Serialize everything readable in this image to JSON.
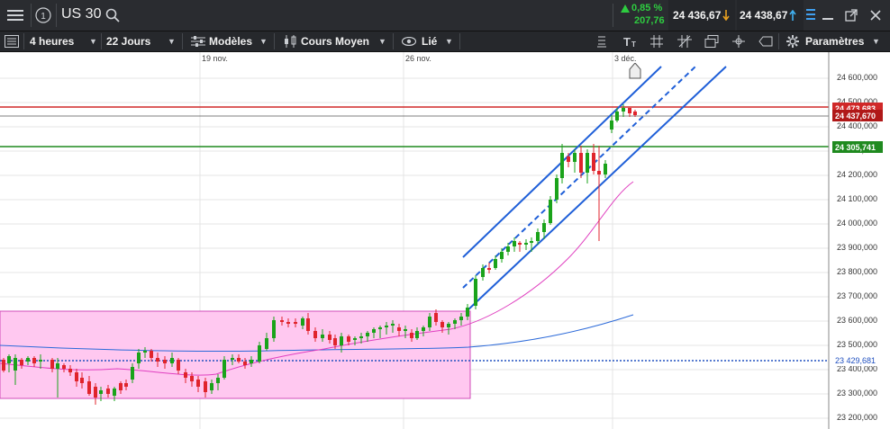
{
  "header": {
    "symbol": "US 30",
    "change_pct": "0,85 %",
    "change_abs": "207,76",
    "sell_price": "24 436,67",
    "buy_price": "24 438,67",
    "number_badge": "1"
  },
  "toolbar": {
    "timeframe": "4 heures",
    "range": "22 Jours",
    "models": "Modèles",
    "price_type": "Cours Moyen",
    "link": "Lié",
    "settings": "Paramètres"
  },
  "chart": {
    "date_labels": [
      "19 nov.",
      "26 nov.",
      "3 déc."
    ],
    "y_ticks": [
      "24 600,000",
      "24 500,000",
      "24 400,000",
      "24 300,000",
      "24 200,000",
      "24 100,000",
      "24 000,000",
      "23 900,000",
      "23 800,000",
      "23 700,000",
      "23 600,000",
      "23 500,000",
      "23 400,000",
      "23 300,000",
      "23 200,000"
    ],
    "price_tags": {
      "red_line": "24 473,683",
      "current": "24 437,670",
      "green_line": "24 305,741",
      "blue_dotted": "23 429,681"
    },
    "colors": {
      "up": "#1aa31a",
      "down": "#e0242c",
      "channel": "#1f5fd8",
      "ma_fast": "#e040c0",
      "ma_slow": "#2c6ad9",
      "zone": "#ffc8f0"
    }
  }
}
